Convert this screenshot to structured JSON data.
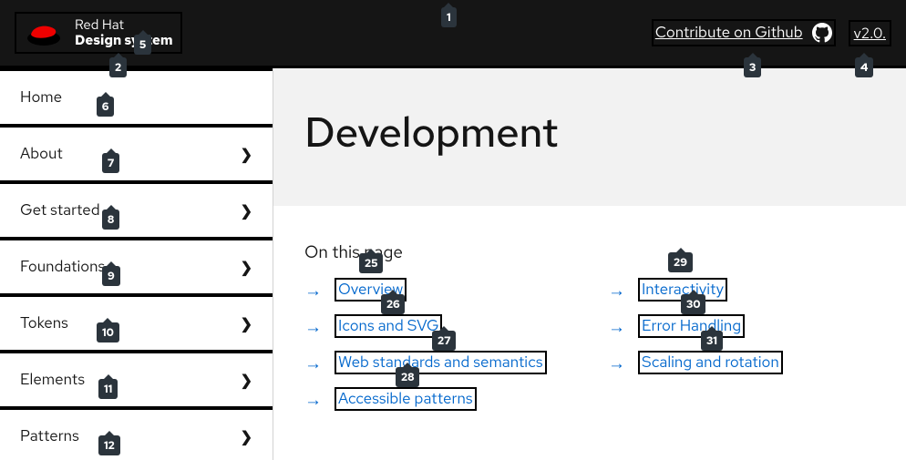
{
  "header": {
    "brand_line1": "Red Hat",
    "brand_line2": "Design system",
    "contribute": "Contribute on Github",
    "version": "v2.0."
  },
  "sidebar": {
    "items": [
      {
        "label": "Home",
        "expandable": false
      },
      {
        "label": "About",
        "expandable": true
      },
      {
        "label": "Get started",
        "expandable": true
      },
      {
        "label": "Foundations",
        "expandable": true
      },
      {
        "label": "Tokens",
        "expandable": true
      },
      {
        "label": "Elements",
        "expandable": true
      },
      {
        "label": "Patterns",
        "expandable": true
      }
    ]
  },
  "page": {
    "title": "Development",
    "on_this_page": "On this page"
  },
  "toc": {
    "col1": [
      "Overview",
      "Icons and SVG",
      "Web standards and semantics",
      "Accessible patterns"
    ],
    "col2": [
      "Interactivity",
      "Error Handling",
      "Scaling and rotation"
    ]
  },
  "markers": {
    "m1": "1",
    "m2": "2",
    "m3": "3",
    "m4": "4",
    "m5": "5",
    "m6": "6",
    "m7": "7",
    "m8": "8",
    "m9": "9",
    "m10": "10",
    "m11": "11",
    "m12": "12",
    "m25": "25",
    "m26": "26",
    "m27": "27",
    "m28": "28",
    "m29": "29",
    "m30": "30",
    "m31": "31"
  }
}
